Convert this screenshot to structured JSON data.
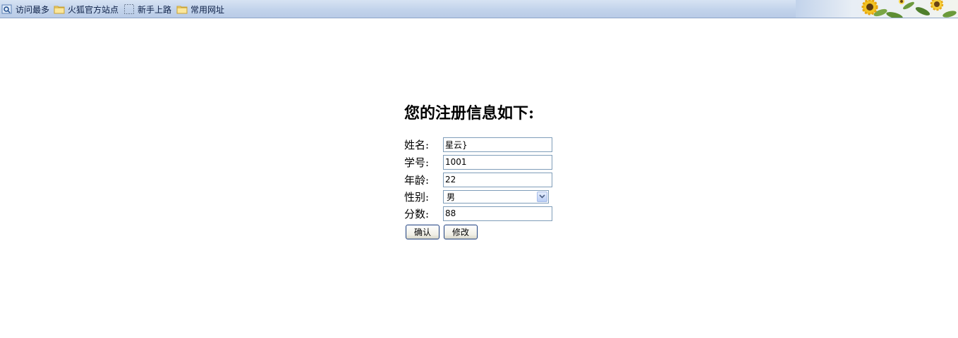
{
  "bookmarks": {
    "items": [
      {
        "label": "访问最多",
        "icon": "search-page-icon"
      },
      {
        "label": "火狐官方站点",
        "icon": "folder-icon"
      },
      {
        "label": "新手上路",
        "icon": "dashed-page-icon"
      },
      {
        "label": "常用网址",
        "icon": "folder-icon"
      }
    ],
    "decoration": "sunflower-decoration"
  },
  "form": {
    "title": "您的注册信息如下:",
    "fields": {
      "name": {
        "label": "姓名:",
        "value": "星云}"
      },
      "student_id": {
        "label": "学号:",
        "value": "1001"
      },
      "age": {
        "label": "年龄:",
        "value": "22"
      },
      "gender": {
        "label": "性别:",
        "value": "男"
      },
      "score": {
        "label": "分数:",
        "value": "88"
      }
    },
    "buttons": {
      "confirm": "确认",
      "modify": "修改"
    }
  },
  "colors": {
    "toolbar_bg": "#c2d3eb",
    "input_border": "#7f9db9",
    "button_border": "#1c3e7e"
  }
}
